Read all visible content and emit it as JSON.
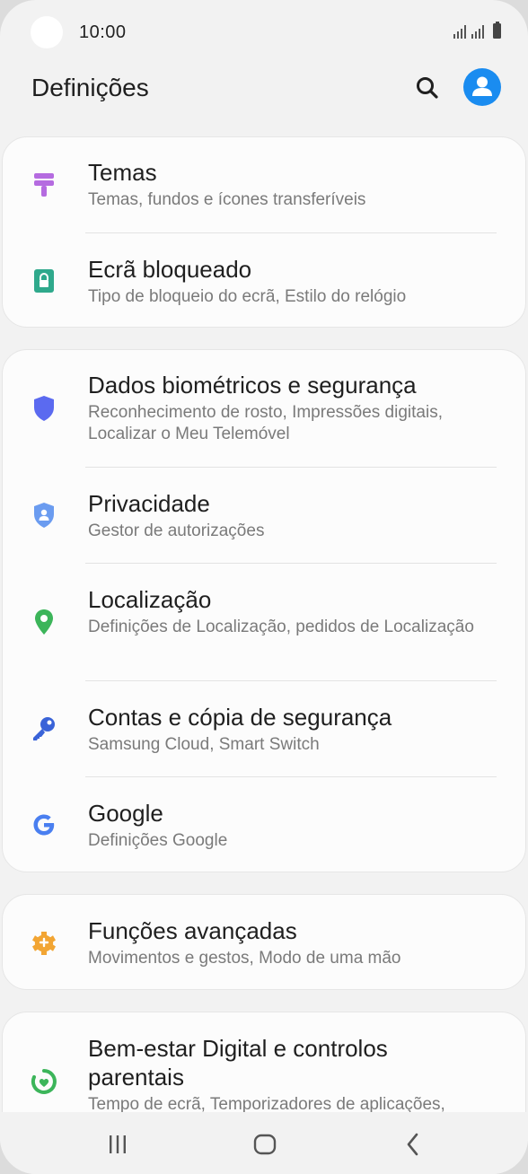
{
  "status_bar": {
    "time": "10:00"
  },
  "header": {
    "title": "Definições"
  },
  "colors": {
    "accent": "#1a8cf0",
    "themes_icon": "#b56be0",
    "lock_icon": "#2fa98c",
    "biometrics_icon": "#5b6af0",
    "privacy_icon": "#6b9cf0",
    "location_icon": "#3cb55a",
    "accounts_icon": "#3a63d8",
    "advanced_icon": "#f2a533",
    "wellbeing_icon": "#3cb55a"
  },
  "cards": [
    {
      "items": [
        {
          "icon": "paint-roller-icon",
          "title": "Temas",
          "subtitle": "Temas, fundos e ícones transferíveis"
        },
        {
          "icon": "lock-icon",
          "title": "Ecrã bloqueado",
          "subtitle": "Tipo de bloqueio do ecrã, Estilo do relógio"
        }
      ]
    },
    {
      "items": [
        {
          "icon": "shield-icon",
          "title": "Dados biométricos e segurança",
          "subtitle": "Reconhecimento de rosto, Impressões digitais, Localizar o Meu Telemóvel"
        },
        {
          "icon": "privacy-shield-icon",
          "title": "Privacidade",
          "subtitle": "Gestor de autorizações"
        },
        {
          "icon": "location-pin-icon",
          "title": "Localização",
          "subtitle": "Definições de Localização, pedidos de Localização"
        },
        {
          "icon": "key-icon",
          "title": "Contas e cópia de segurança",
          "subtitle": "Samsung Cloud, Smart Switch"
        },
        {
          "icon": "google-icon",
          "title": "Google",
          "subtitle": "Definições Google"
        }
      ]
    },
    {
      "items": [
        {
          "icon": "puzzle-gear-icon",
          "title": "Funções avançadas",
          "subtitle": "Movimentos e gestos, Modo de uma mão"
        }
      ]
    },
    {
      "items": [
        {
          "icon": "wellbeing-icon",
          "title": "Bem-estar Digital e controlos parentais",
          "subtitle": "Tempo de ecrã, Temporizadores de aplicações,"
        }
      ]
    }
  ],
  "nav": {
    "recents": "recents-icon",
    "home": "home-icon",
    "back": "back-icon"
  }
}
